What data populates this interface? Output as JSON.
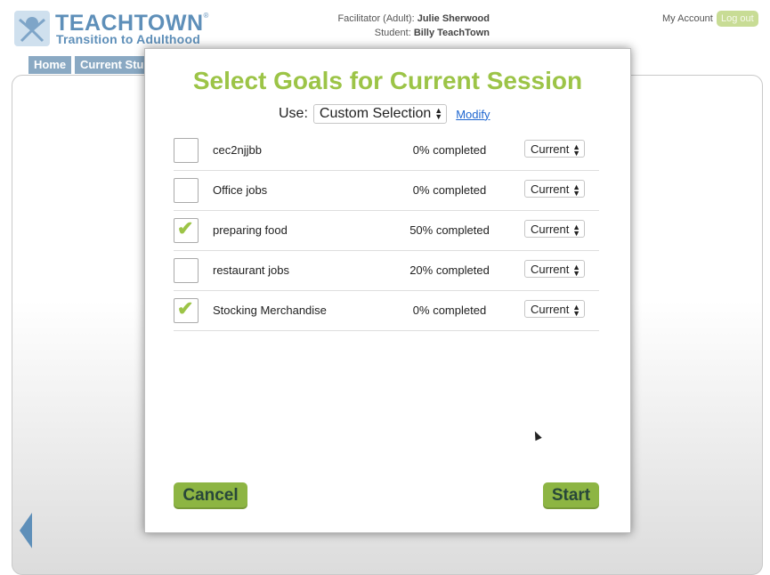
{
  "header": {
    "brand": "TEACHTOWN",
    "brand_mark": "®",
    "tagline": "Transition to Adulthood",
    "facilitator_label": "Facilitator (Adult):",
    "facilitator_name": "Julie Sherwood",
    "student_label": "Student:",
    "student_name": "Billy TeachTown",
    "my_account": "My Account",
    "logout": "Log out"
  },
  "tabs": [
    {
      "label": "Home"
    },
    {
      "label": "Current Stu"
    }
  ],
  "modal": {
    "title": "Select Goals for Current Session",
    "use_label": "Use:",
    "use_value": "Custom Selection",
    "modify": "Modify",
    "goals": [
      {
        "name": "cec2njjbb",
        "progress": "0% completed",
        "status": "Current",
        "checked": false
      },
      {
        "name": "Office jobs",
        "progress": "0% completed",
        "status": "Current",
        "checked": false
      },
      {
        "name": "preparing food",
        "progress": "50% completed",
        "status": "Current",
        "checked": true
      },
      {
        "name": "restaurant jobs",
        "progress": "20% completed",
        "status": "Current",
        "checked": false
      },
      {
        "name": "Stocking Merchandise",
        "progress": "0% completed",
        "status": "Current",
        "checked": true
      }
    ],
    "cancel": "Cancel",
    "start": "Start"
  },
  "colors": {
    "title_green": "#9cc447",
    "button_green": "#8db543",
    "brand_blue": "#5e8fb9",
    "tab_blue": "#8aa9c3"
  }
}
